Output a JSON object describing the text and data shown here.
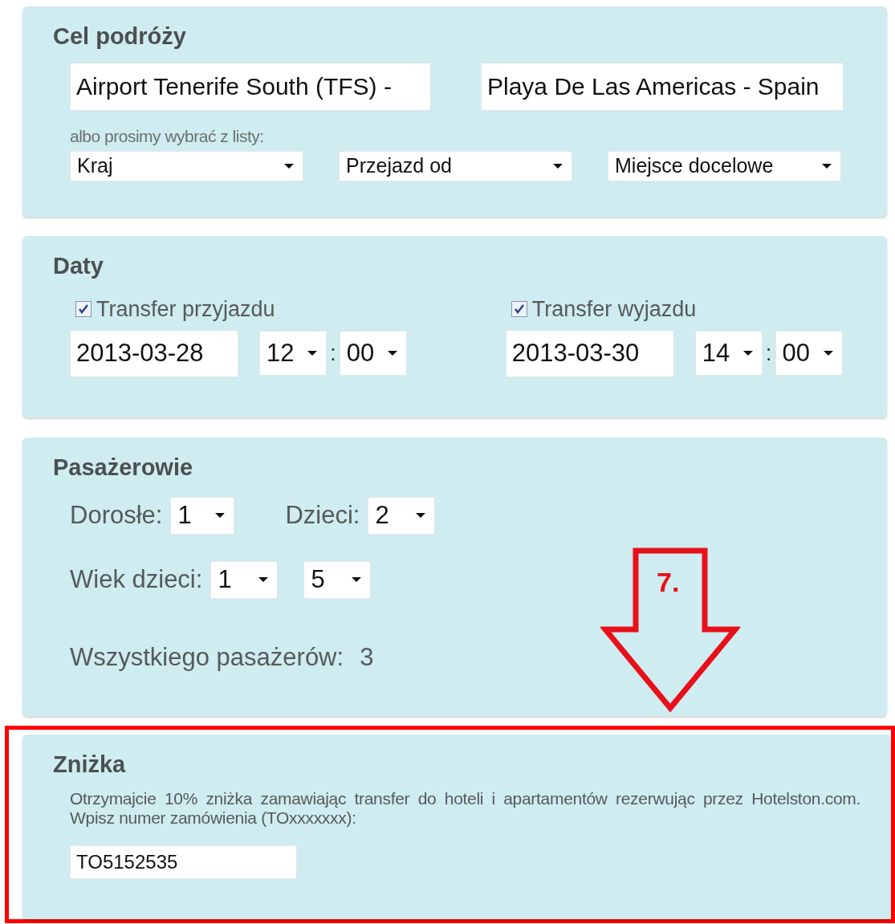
{
  "destination": {
    "title": "Cel podróży",
    "from_value": "Airport Tenerife South (TFS) -",
    "to_value": "Playa De Las Americas - Spain",
    "hint": "albo prosimy wybrać z listy:",
    "dropdowns": [
      "Kraj",
      "Przejazd od",
      "Miejsce docelowe"
    ]
  },
  "dates": {
    "title": "Daty",
    "transfers": [
      {
        "label": "Transfer przyjazdu",
        "checked": true,
        "date": "2013-03-28",
        "hour": "12",
        "separator": ":",
        "minute": "00"
      },
      {
        "label": "Transfer wyjazdu",
        "checked": true,
        "date": "2013-03-30",
        "hour": "14",
        "separator": ":",
        "minute": "00"
      }
    ]
  },
  "passengers": {
    "title": "Pasażerowie",
    "adults_label": "Dorosłe:",
    "adults": "1",
    "children_label": "Dzieci:",
    "children": "2",
    "ages_label": "Wiek dzieci:",
    "ages": [
      "1",
      "5"
    ],
    "total_label": "Wszystkiego pasażerów:",
    "total": "3"
  },
  "discount": {
    "title": "Zniżka",
    "highlighted": true,
    "text": "Otrzymajcie 10% zniżka zamawiając transfer do hoteli i apartamentów rezerwując przez Hotelston.com. Wpisz numer zamówienia (TOxxxxxxx):",
    "code": "TO5152535"
  },
  "annotation": {
    "label": "7."
  }
}
